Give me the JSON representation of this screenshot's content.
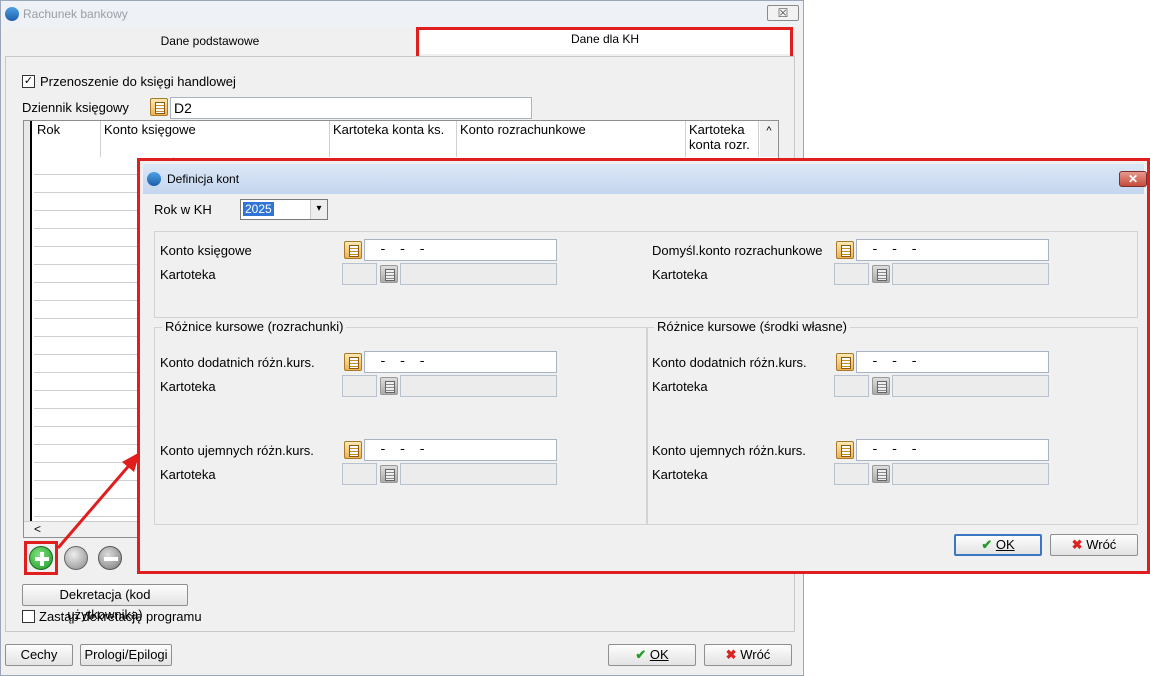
{
  "main_window": {
    "title": "Rachunek bankowy",
    "close_glyph": "☒",
    "tabs": [
      {
        "label": "Dane podstawowe"
      },
      {
        "label": "Dane dla KH"
      }
    ],
    "transfer_checkbox": {
      "label": "Przenoszenie do księgi handlowej",
      "checked": true
    },
    "journal": {
      "label": "Dziennik księgowy",
      "value": "D2"
    },
    "grid_columns": [
      "Rok",
      "Konto księgowe",
      "Kartoteka konta ks.",
      "Konto rozrachunkowe",
      "Kartoteka konta rozr."
    ],
    "scroll_left_glyph": "<",
    "scroll_up_glyph": "^",
    "icons": [
      "plus-icon",
      "search-icon",
      "minus-icon"
    ],
    "decree_button": "Dekretacja (kod użytkownika)",
    "replace_checkbox": {
      "label": "Zastąp dekretację programu",
      "checked": false
    },
    "bottom_buttons": {
      "features": "Cechy",
      "prologs": "Prologi/Epilogi",
      "ok": "OK",
      "back": "Wróć"
    }
  },
  "dialog": {
    "title": "Definicja kont",
    "close_glyph": "✕",
    "year": {
      "label": "Rok w KH",
      "value": "2025"
    },
    "top": {
      "account_label": "Konto księgowe",
      "account_value": "- - -",
      "card_label": "Kartoteka",
      "default_label": "Domyśl.konto rozrachunkowe",
      "default_value": "- - -",
      "default_card_label": "Kartoteka"
    },
    "left_group": {
      "title": "Różnice kursowe (rozrachunki)",
      "positive_label": "Konto dodatnich różn.kurs.",
      "positive_value": "- - -",
      "negative_label": "Konto ujemnych różn.kurs.",
      "negative_value": "- - -",
      "card_label": "Kartoteka"
    },
    "right_group": {
      "title": "Różnice kursowe (środki własne)",
      "positive_label": "Konto dodatnich różn.kurs.",
      "positive_value": "- - -",
      "negative_label": "Konto ujemnych różn.kurs.",
      "negative_value": "- - -",
      "card_label": "Kartoteka"
    },
    "buttons": {
      "ok": "OK",
      "back": "Wróć"
    }
  },
  "colors": {
    "highlight": "#e01e1e",
    "selection": "#3075d6"
  }
}
